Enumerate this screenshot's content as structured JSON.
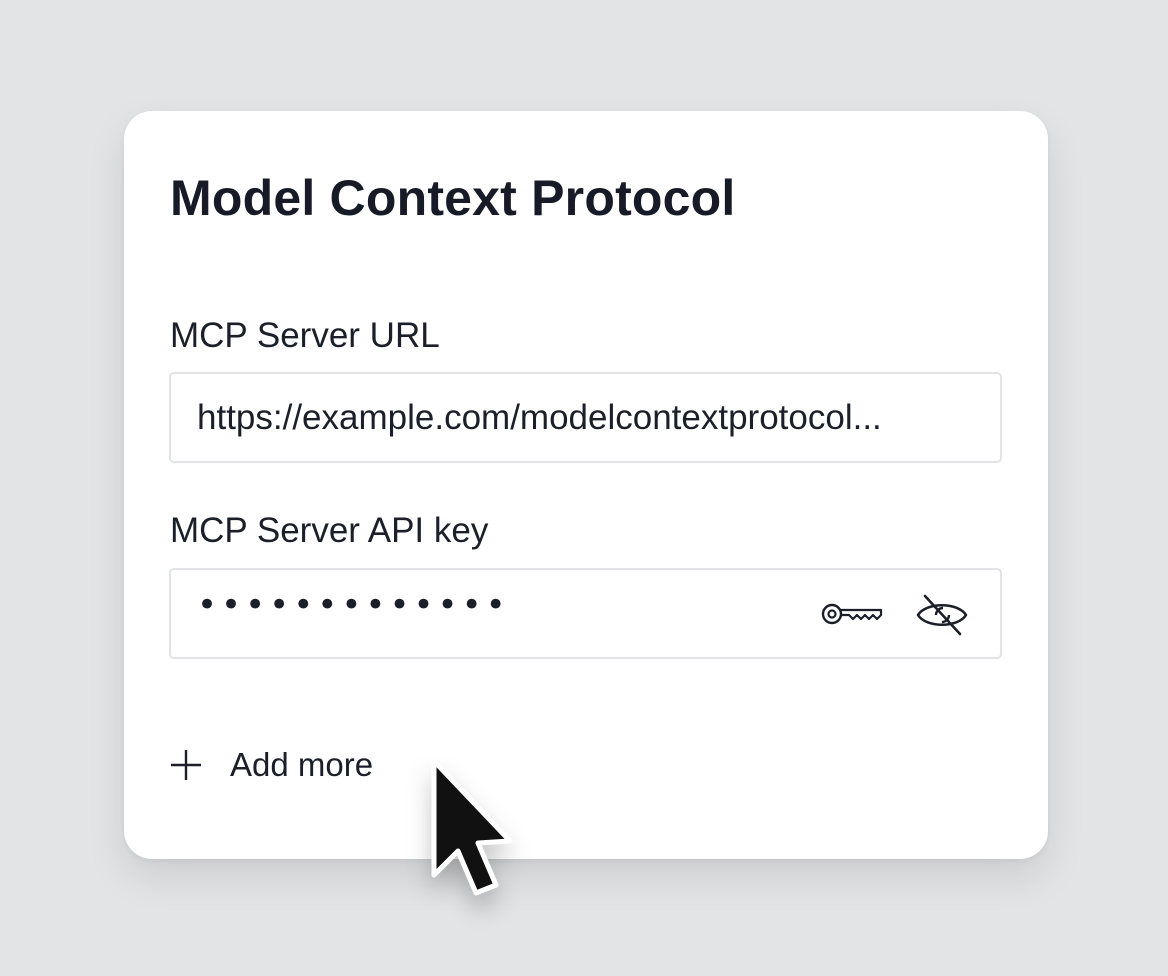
{
  "title": "Model Context Protocol",
  "fields": {
    "url": {
      "label": "MCP Server URL",
      "value": "https://example.com/modelcontextprotocol..."
    },
    "api_key": {
      "label": "MCP Server API key",
      "masked_value": "•••••••••••••"
    }
  },
  "add_more": {
    "label": "Add more"
  },
  "icons": {
    "key": "key-icon",
    "visibility": "eye-slash-icon",
    "add": "plus-icon",
    "pointer": "mouse-cursor-icon"
  },
  "colors": {
    "background": "#e3e4e6",
    "card": "#ffffff",
    "text": "#171c26",
    "border": "#e1e3e6"
  }
}
